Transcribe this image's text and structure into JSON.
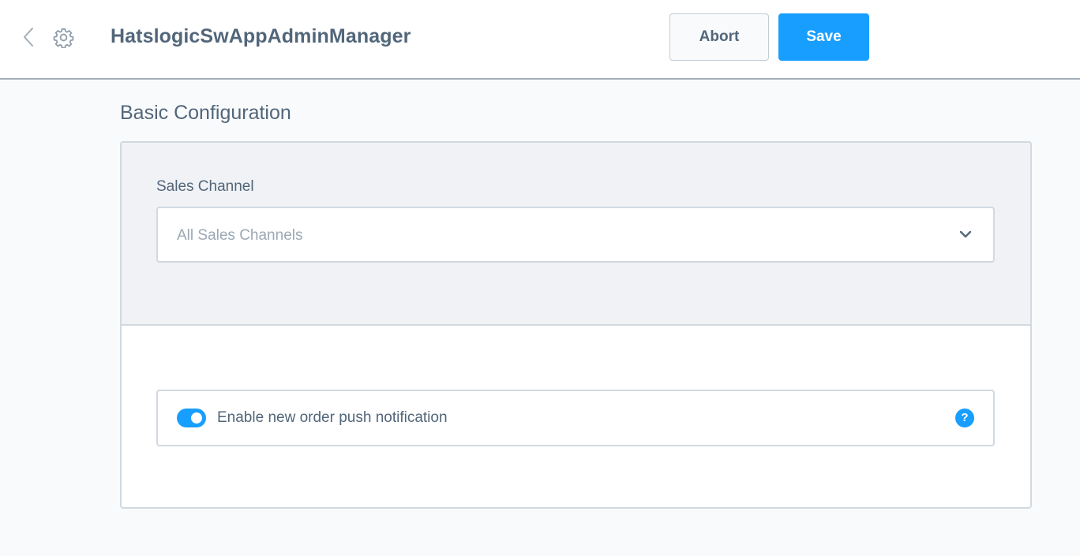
{
  "header": {
    "title": "HatslogicSwAppAdminManager",
    "back_icon": "chevron-left-icon",
    "settings_icon": "gear-icon",
    "abort_label": "Abort",
    "save_label": "Save"
  },
  "main": {
    "section_title": "Basic Configuration",
    "sales_channel": {
      "label": "Sales Channel",
      "placeholder": "All Sales Channels",
      "icon": "chevron-down-icon"
    },
    "push_notification": {
      "label": "Enable new order push notification",
      "enabled": true,
      "help_icon": "question-mark-icon",
      "help_glyph": "?"
    }
  },
  "colors": {
    "accent": "#189eff",
    "text": "#52667a",
    "placeholder": "#9aa8b5",
    "border": "#d1d9e0",
    "panel_background": "#f0f2f5",
    "page_background": "#f9fafb"
  }
}
